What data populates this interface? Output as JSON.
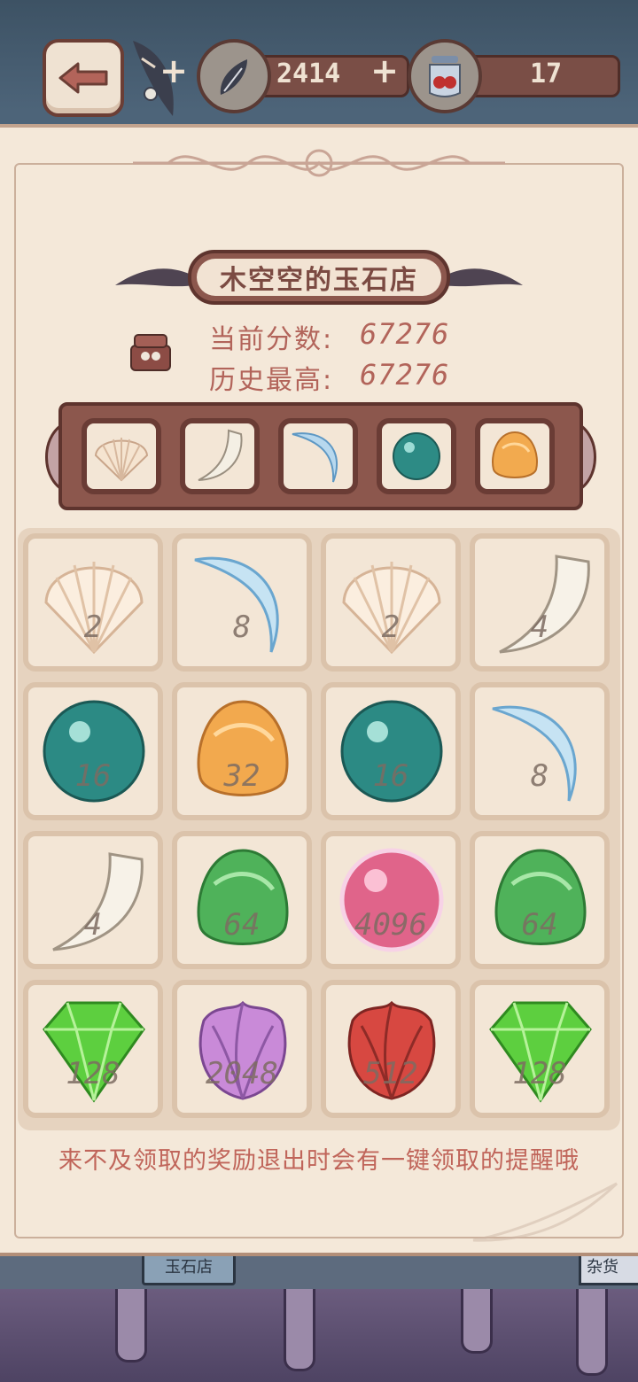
{
  "top_bar": {
    "resource1": {
      "icon": "feather-icon",
      "value": "2414",
      "plus": "+"
    },
    "resource2": {
      "icon": "berry-jar-icon",
      "value": "17",
      "plus": "+"
    }
  },
  "background": {
    "shop_sign": "玉石店",
    "sign2": "杂货"
  },
  "shop": {
    "title": "木空空的玉石店",
    "current_score_label": "当前分数:",
    "current_score": "67276",
    "best_score_label": "历史最高:",
    "best_score": "67276"
  },
  "target_items": [
    "shell",
    "tooth",
    "claw",
    "teal-pearl",
    "amber-gem"
  ],
  "grid": [
    [
      {
        "item": "shell",
        "value": "2"
      },
      {
        "item": "claw",
        "value": "8"
      },
      {
        "item": "shell",
        "value": "2"
      },
      {
        "item": "tooth",
        "value": "4"
      }
    ],
    [
      {
        "item": "teal-pearl",
        "value": "16"
      },
      {
        "item": "amber-gem",
        "value": "32"
      },
      {
        "item": "teal-pearl",
        "value": "16"
      },
      {
        "item": "claw",
        "value": "8"
      }
    ],
    [
      {
        "item": "tooth",
        "value": "4"
      },
      {
        "item": "green-gem",
        "value": "64"
      },
      {
        "item": "pink-pearl",
        "value": "4096"
      },
      {
        "item": "green-gem",
        "value": "64"
      }
    ],
    [
      {
        "item": "emerald",
        "value": "128"
      },
      {
        "item": "purple-flower",
        "value": "2048"
      },
      {
        "item": "red-flower",
        "value": "512"
      },
      {
        "item": "emerald",
        "value": "128"
      }
    ]
  ],
  "tip": "来不及领取的奖励退出时会有一键领取的提醒哦",
  "colors": {
    "panel": "#f4e8d9",
    "frame": "#8c574d",
    "accent_text": "#c0655a"
  }
}
